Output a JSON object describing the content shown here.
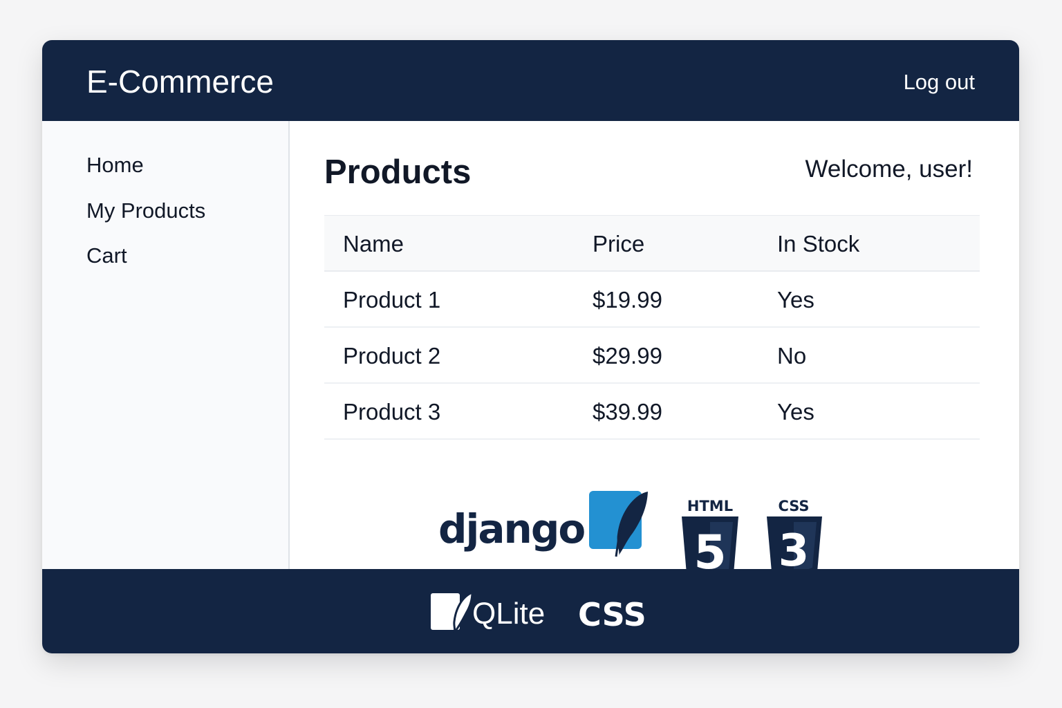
{
  "header": {
    "brand": "E-Commerce",
    "logout_label": "Log out"
  },
  "sidebar": {
    "items": [
      {
        "label": "Home"
      },
      {
        "label": "My Products"
      },
      {
        "label": "Cart"
      }
    ]
  },
  "main": {
    "title": "Products",
    "welcome": "Welcome, user!",
    "table": {
      "columns": [
        "Name",
        "Price",
        "In Stock"
      ],
      "rows": [
        {
          "name": "Product 1",
          "price": "$19.99",
          "in_stock": "Yes"
        },
        {
          "name": "Product 2",
          "price": "$29.99",
          "in_stock": "No"
        },
        {
          "name": "Product 3",
          "price": "$39.99",
          "in_stock": "Yes"
        }
      ]
    },
    "logos": {
      "django": "django",
      "html_badge": "HTML",
      "html_number": "5",
      "css_badge": "CSS",
      "css_number": "3",
      "icons": [
        "django-logo",
        "sqlite-feather-icon",
        "html5-shield-icon",
        "css3-shield-icon"
      ]
    }
  },
  "footer": {
    "sqlite_text": "QLite",
    "css_text": "CSS",
    "icons": [
      "sqlite-logo-icon"
    ]
  },
  "colors": {
    "navy": "#132543",
    "sidebar_bg": "#f9fafc",
    "sqlite_blue": "#2391d2",
    "text": "#111827"
  }
}
